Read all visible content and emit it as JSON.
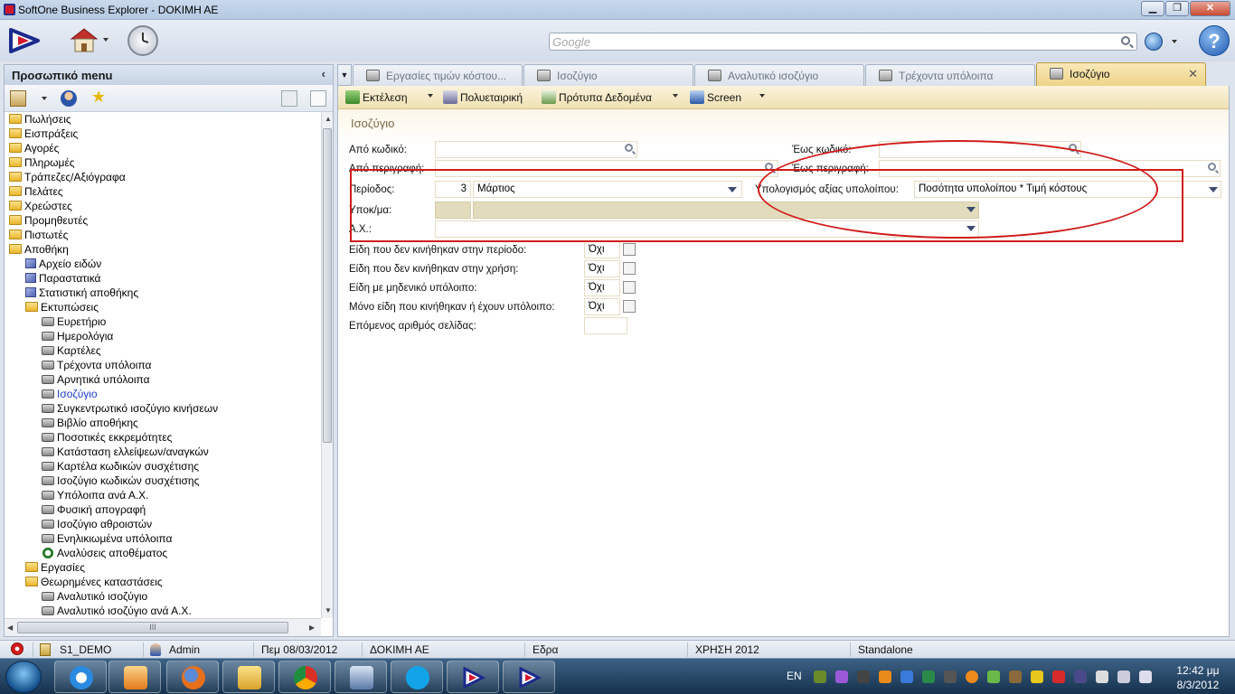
{
  "window": {
    "title": "SoftOne Business Explorer - DOKIMH AE",
    "minimize": "▁",
    "restore": "❐",
    "close": "✕"
  },
  "search": {
    "placeholder": "Google"
  },
  "help": {
    "label": "?"
  },
  "left_panel": {
    "title": "Προσωπικό menu",
    "collapse": "‹",
    "tree": [
      {
        "label": "Πωλήσεις",
        "icon": "folder-icon",
        "level": 0
      },
      {
        "label": "Εισπράξεις",
        "icon": "folder-icon",
        "level": 0
      },
      {
        "label": "Αγορές",
        "icon": "folder-icon",
        "level": 0
      },
      {
        "label": "Πληρωμές",
        "icon": "folder-icon",
        "level": 0
      },
      {
        "label": "Τράπεζες/Αξιόγραφα",
        "icon": "folder-icon",
        "level": 0
      },
      {
        "label": "Πελάτες",
        "icon": "folder-icon",
        "level": 0
      },
      {
        "label": "Χρεώστες",
        "icon": "folder-icon",
        "level": 0
      },
      {
        "label": "Προμηθευτές",
        "icon": "folder-icon",
        "level": 0
      },
      {
        "label": "Πιστωτές",
        "icon": "folder-icon",
        "level": 0
      },
      {
        "label": "Αποθήκη",
        "icon": "folder-open-icon",
        "level": 0
      },
      {
        "label": "Αρχείο ειδών",
        "icon": "cube-icon",
        "level": 1
      },
      {
        "label": "Παραστατικά",
        "icon": "cube-icon",
        "level": 1
      },
      {
        "label": "Στατιστική αποθήκης",
        "icon": "cube-icon",
        "level": 1
      },
      {
        "label": "Εκτυπώσεις",
        "icon": "folder-open-icon",
        "level": 1
      },
      {
        "label": "Ευρετήριο",
        "icon": "printer-icon",
        "level": 2
      },
      {
        "label": "Ημερολόγια",
        "icon": "printer-icon",
        "level": 2
      },
      {
        "label": "Καρτέλες",
        "icon": "printer-icon",
        "level": 2
      },
      {
        "label": "Τρέχοντα υπόλοιπα",
        "icon": "printer-icon",
        "level": 2
      },
      {
        "label": "Αρνητικά υπόλοιπα",
        "icon": "printer-icon",
        "level": 2
      },
      {
        "label": "Ισοζύγιο",
        "icon": "printer-icon",
        "level": 2,
        "selected": true
      },
      {
        "label": "Συγκεντρωτικό ισοζύγιο κινήσεων",
        "icon": "printer-icon",
        "level": 2
      },
      {
        "label": "Βιβλίο αποθήκης",
        "icon": "printer-icon",
        "level": 2
      },
      {
        "label": "Ποσοτικές εκκρεμότητες",
        "icon": "printer-icon",
        "level": 2
      },
      {
        "label": "Κατάσταση ελλείψεων/αναγκών",
        "icon": "printer-icon",
        "level": 2
      },
      {
        "label": "Καρτέλα κωδικών συσχέτισης",
        "icon": "printer-icon",
        "level": 2
      },
      {
        "label": "Ισοζύγιο κωδικών συσχέτισης",
        "icon": "printer-icon",
        "level": 2
      },
      {
        "label": "Υπόλοιπα ανά Α.Χ.",
        "icon": "printer-icon",
        "level": 2
      },
      {
        "label": "Φυσική απογραφή",
        "icon": "printer-icon",
        "level": 2
      },
      {
        "label": "Ισοζύγιο αθροιστών",
        "icon": "printer-icon",
        "level": 2
      },
      {
        "label": "Ενηλικιωμένα υπόλοιπα",
        "icon": "printer-icon",
        "level": 2
      },
      {
        "label": "Αναλύσεις αποθέματος",
        "icon": "lens-icon",
        "level": 2
      },
      {
        "label": "Εργασίες",
        "icon": "folder-icon",
        "level": 1
      },
      {
        "label": "Θεωρημένες καταστάσεις",
        "icon": "folder-open-icon",
        "level": 1
      },
      {
        "label": "Αναλυτικό ισοζύγιο",
        "icon": "printer-icon",
        "level": 2
      },
      {
        "label": "Αναλυτικό ισοζύγιο ανά Α.Χ.",
        "icon": "printer-icon",
        "level": 2
      }
    ],
    "hscroll_grip": "III"
  },
  "tabs": [
    {
      "label": "Εργασίες τιμών κόστου...",
      "active": false
    },
    {
      "label": "Ισοζύγιο",
      "active": false
    },
    {
      "label": "Αναλυτικό ισοζύγιο",
      "active": false
    },
    {
      "label": "Τρέχοντα υπόλοιπα",
      "active": false
    },
    {
      "label": "Ισοζύγιο",
      "active": true
    }
  ],
  "tab_close": "✕",
  "content_toolbar": {
    "run": "Εκτέλεση",
    "multicompany": "Πολυεταιρική",
    "templates": "Πρότυπα Δεδομένα",
    "screen": "Screen"
  },
  "form": {
    "title": "Ισοζύγιο",
    "from_code_label": "Από κωδικό:",
    "to_code_label": "Έως κωδικό:",
    "from_desc_label": "Από περιγραφή:",
    "to_desc_label": "Έως περιγραφή:",
    "period_label": "Περίοδος:",
    "period_number": "3",
    "period_name": "Μάρτιος",
    "calc_label": "Υπολογισμός αξίας υπολοίπου:",
    "calc_value": "Ποσότητα υπολοίπου * Τιμή κόστους",
    "branch_label": "Υποκ/μα:",
    "warehouse_label": "Α.Χ.:",
    "options": [
      {
        "label": "Είδη που δεν κινήθηκαν στην περίοδο:",
        "value": "Όχι"
      },
      {
        "label": "Είδη που δεν κινήθηκαν στην χρήση:",
        "value": "Όχι"
      },
      {
        "label": "Είδη με μηδενικό υπόλοιπο:",
        "value": "Όχι"
      },
      {
        "label": "Μόνο είδη που κινήθηκαν ή έχουν υπόλοιπο:",
        "value": "Όχι"
      }
    ],
    "next_page_label": "Επόμενος αριθμός σελίδας:",
    "next_page_value": ""
  },
  "statusbar": {
    "company": "S1_DEMO",
    "user": "Admin",
    "date": "Πεμ 08/03/2012",
    "company_name": "ΔΟΚΙΜΗ ΑΕ",
    "branch": "Εδρα",
    "fiscal_year": "ΧΡΗΣΗ 2012",
    "mode": "Standalone"
  },
  "taskbar": {
    "lang": "EN",
    "time": "12:42 μμ",
    "date": "8/3/2012"
  }
}
